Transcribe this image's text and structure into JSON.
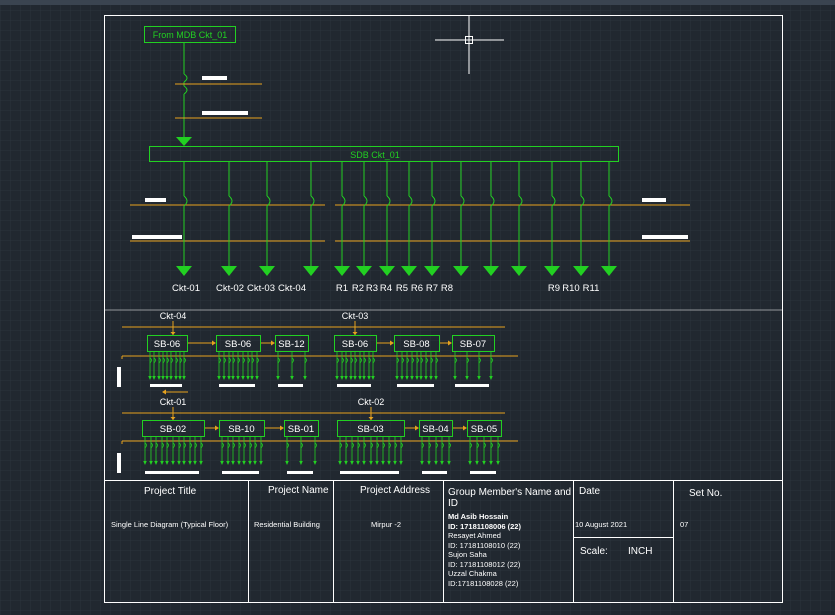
{
  "diagram": {
    "source_label": "From MDB Ckt_01",
    "busbar_label": "SDB Ckt_01",
    "outgoing_labels": [
      "Ckt-01",
      "Ckt-02",
      "Ckt-03",
      "Ckt-04",
      "R1",
      "R2",
      "R3",
      "R4",
      "R5",
      "R6",
      "R7",
      "R8",
      "R9",
      "R10",
      "R11"
    ],
    "row1": {
      "ckt_left": "Ckt-04",
      "ckt_right": "Ckt-03",
      "boxes": [
        "SB-06",
        "SB-06",
        "SB-12",
        "SB-06",
        "SB-08",
        "SB-07"
      ]
    },
    "row2": {
      "ckt_left": "Ckt-01",
      "ckt_right": "Ckt-02",
      "boxes": [
        "SB-02",
        "SB-10",
        "SB-01",
        "SB-03",
        "SB-04",
        "SB-05"
      ]
    }
  },
  "title_block": {
    "project_title_header": "Project Title",
    "project_title_value": "Single Line Diagram (Typical Floor)",
    "project_name_header": "Project Name",
    "project_name_value": "Residential Building",
    "project_address_header": "Project Address",
    "project_address_value": "Mirpur -2",
    "members_header": "Group Member's Name and ID",
    "members": [
      {
        "name": "Md Asib Hossain",
        "id": "ID:     17181108006 (22)"
      },
      {
        "name": "Resayet Ahmed",
        "id": "ID:     17181108010 (22)"
      },
      {
        "name": "Sujon Saha",
        "id": "ID:     17181108012 (22)"
      },
      {
        "name": "Uzzal Chakma",
        "id": "ID:17181108028 (22)"
      }
    ],
    "date_header": "Date",
    "date_value": "10 August 2021",
    "scale_label": "Scale:",
    "scale_value": "INCH",
    "set_header": "Set No.",
    "set_value": "07"
  },
  "colors": {
    "background": "#212830",
    "green": "#22d022",
    "orange": "#e6a21e",
    "white": "#ffffff"
  }
}
